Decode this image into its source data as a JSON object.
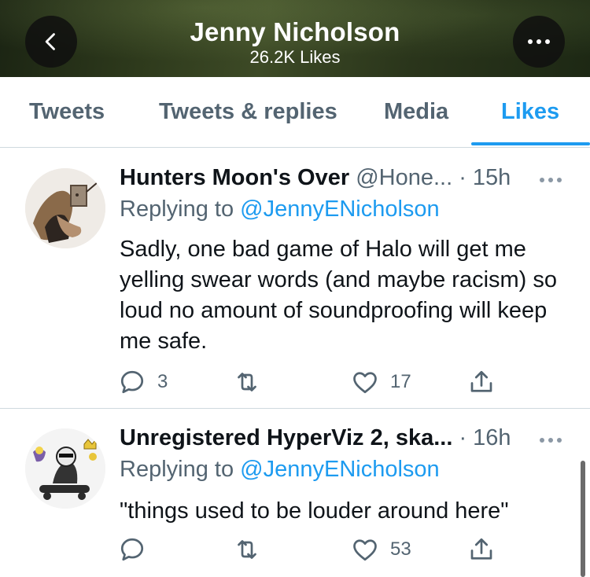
{
  "header": {
    "title": "Jenny Nicholson",
    "subtitle": "26.2K Likes",
    "back_icon": "chevron-left-icon",
    "more_icon": "more-horizontal-icon"
  },
  "tabs": [
    {
      "label": "Tweets"
    },
    {
      "label": "Tweets & replies"
    },
    {
      "label": "Media"
    },
    {
      "label": "Likes",
      "active": true
    }
  ],
  "tweets": [
    {
      "name": "Hunters Moon's Over",
      "handle": "@Hone...",
      "time": "· 15h",
      "replying_prefix": "Replying to ",
      "replying_to": "@JennyENicholson",
      "text": "Sadly, one bad game of Halo will get me yelling swear words (and maybe racism) so loud no amount of soundproofing will keep me safe.",
      "replies": "3",
      "retweets": "",
      "likes": "17"
    },
    {
      "name": "Unregistered HyperViz 2, ska...",
      "handle": "",
      "time": "· 16h",
      "replying_prefix": "Replying to ",
      "replying_to": "@JennyENicholson",
      "text": "\"things used to be louder around here\"",
      "replies": "",
      "retweets": "",
      "likes": "53"
    }
  ],
  "colors": {
    "accent": "#1d9bf0",
    "secondary_text": "#536471",
    "primary_text": "#0f1419",
    "divider": "#cfd9de"
  }
}
